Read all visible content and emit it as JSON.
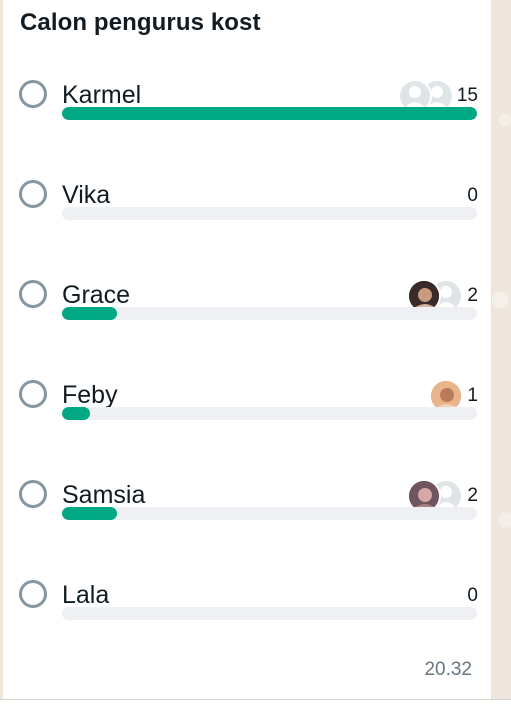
{
  "poll": {
    "title": "Calon pengurus kost",
    "time": "20.32",
    "accent_color": "#00a884",
    "options": [
      {
        "label": "Karmel",
        "count": "15",
        "fraction": 1.0,
        "avatars": [
          "default-avatar-icon",
          "default-avatar-icon"
        ]
      },
      {
        "label": "Vika",
        "count": "0",
        "fraction": 0.0,
        "avatars": []
      },
      {
        "label": "Grace",
        "count": "2",
        "fraction": 0.133,
        "avatars": [
          "user-photo-avatar",
          "default-avatar-icon"
        ]
      },
      {
        "label": "Feby",
        "count": "1",
        "fraction": 0.067,
        "avatars": [
          "user-photo-avatar"
        ]
      },
      {
        "label": "Samsia",
        "count": "2",
        "fraction": 0.133,
        "avatars": [
          "user-photo-avatar",
          "default-avatar-icon"
        ]
      },
      {
        "label": "Lala",
        "count": "0",
        "fraction": 0.0,
        "avatars": []
      }
    ]
  }
}
